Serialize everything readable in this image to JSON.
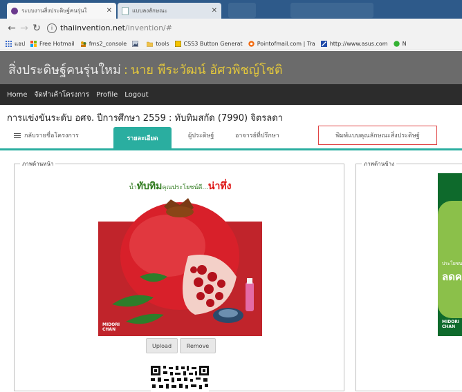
{
  "browser": {
    "tabs": [
      {
        "title": "ระบบงานสิ่งประดิษฐ์คนรุ่นใ",
        "active": true
      },
      {
        "title": "แบบลงลักษณะ",
        "active": false
      }
    ],
    "address": {
      "host": "thaiinvention.net",
      "path": "/invention/#"
    },
    "bookmarks": [
      {
        "label": "แอป",
        "icon": "apps-grid-icon"
      },
      {
        "label": "Free Hotmail",
        "icon": "windows-logo-icon"
      },
      {
        "label": "fms2_console",
        "icon": "people-icon"
      },
      {
        "label": "",
        "icon": "image-icon"
      },
      {
        "label": "tools",
        "icon": "folder-icon"
      },
      {
        "label": "CSS3 Button Generat",
        "icon": "yellow-square-icon"
      },
      {
        "label": "Pointofmail.com | Tra",
        "icon": "orange-circle-icon"
      },
      {
        "label": "http://www.asus.com",
        "icon": "asus-icon"
      },
      {
        "label": "N",
        "icon": "green-circle-icon"
      }
    ]
  },
  "site": {
    "brand": "สิ่งประดิษฐ์คนรุ่นใหม่",
    "brand_sep": ":",
    "user": "นาย พีระวัฒน์ อัศวพิชญ์โชติ",
    "nav": [
      "Home",
      "จัดทำเค้าโครงการ",
      "Profile",
      "Logout"
    ],
    "project_title": "การแข่งขันระดับ อศจ. ปีการศึกษา 2559 : ทับทิมสกัด (7990) จิตรลดา"
  },
  "tabs": {
    "back": "กลับรายชื่อโครงการ",
    "details": "รายละเอียด",
    "inventors": "ผู้ประดิษฐ์",
    "advisors": "อาจารย์ที่ปรึกษา",
    "print": "พิมพ์แบบคุณลักษณะสิ่งประดิษฐ์"
  },
  "panels": {
    "front_legend": "ภาพด้านหน้า",
    "side_legend": "ภาพด้านข้าง",
    "upload": "Upload",
    "remove": "Remove"
  },
  "product": {
    "headline_a": "น้ำ",
    "headline_b": "ทับทิม",
    "headline_c": "คุณประโยชน์ดี...",
    "headline_d": "น่าทึ่ง",
    "brand_line1": "MIDORI",
    "brand_line2": "CHAN",
    "side_text1": "ประโยชน",
    "side_text2": "ลดค",
    "side_brand1": "MIDORI",
    "side_brand2": "CHAN"
  },
  "colors": {
    "accent_teal": "#2aaea0",
    "print_border": "#e04444",
    "banner_bg": "#6b6b6b",
    "nav_bg": "#2c2c2c",
    "brand_user": "#e0c53d"
  }
}
